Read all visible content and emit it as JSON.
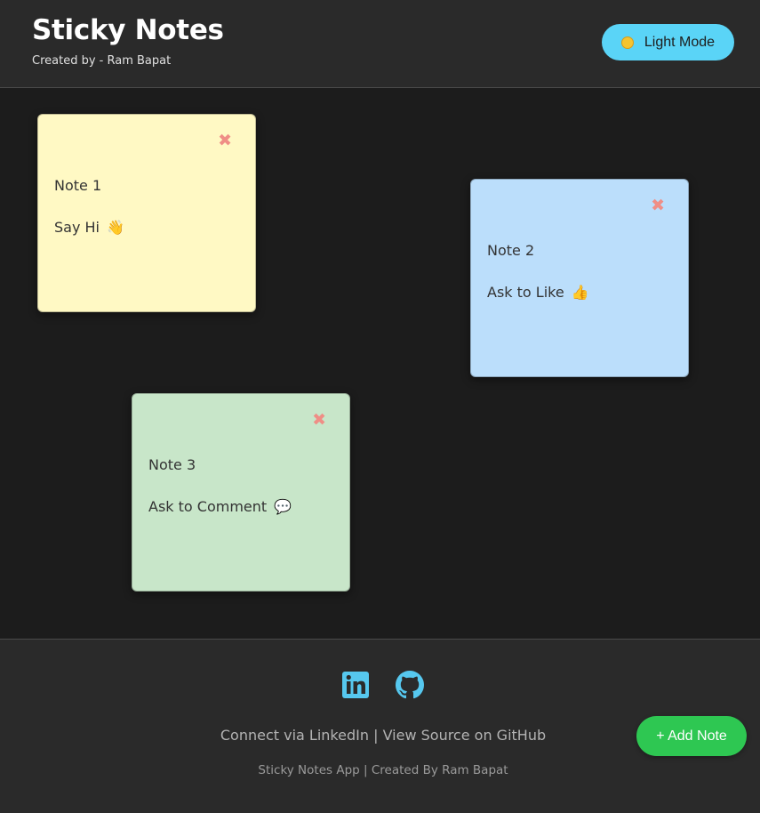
{
  "header": {
    "title": "Sticky Notes",
    "subtitle": "Created by - Ram Bapat",
    "mode_toggle": {
      "label": "Light Mode",
      "icon": "sun-icon",
      "color": "#5ad4f7"
    }
  },
  "notes": [
    {
      "title": "Note 1",
      "body": "Say Hi",
      "emoji": "👋",
      "color": "#fff9c4"
    },
    {
      "title": "Note 2",
      "body": "Ask to Like",
      "emoji": "👍",
      "color": "#bbdefb"
    },
    {
      "title": "Note 3",
      "body": "Ask to Comment",
      "emoji": "💬",
      "color": "#c8e6c9"
    }
  ],
  "note_close_glyph": "✖",
  "footer": {
    "social": [
      {
        "name": "linkedin-icon",
        "color": "#56c8ef"
      },
      {
        "name": "github-icon",
        "color": "#56c8ef"
      }
    ],
    "connect_linkedin": "Connect via LinkedIn",
    "separator": "|",
    "view_source": "View Source on GitHub",
    "credits": "Sticky Notes App | Created By Ram Bapat"
  },
  "add_note_label": "+ Add Note",
  "colors": {
    "background": "#1c1c1c",
    "header": "#2a2a2a",
    "add_button": "#2ec752"
  }
}
